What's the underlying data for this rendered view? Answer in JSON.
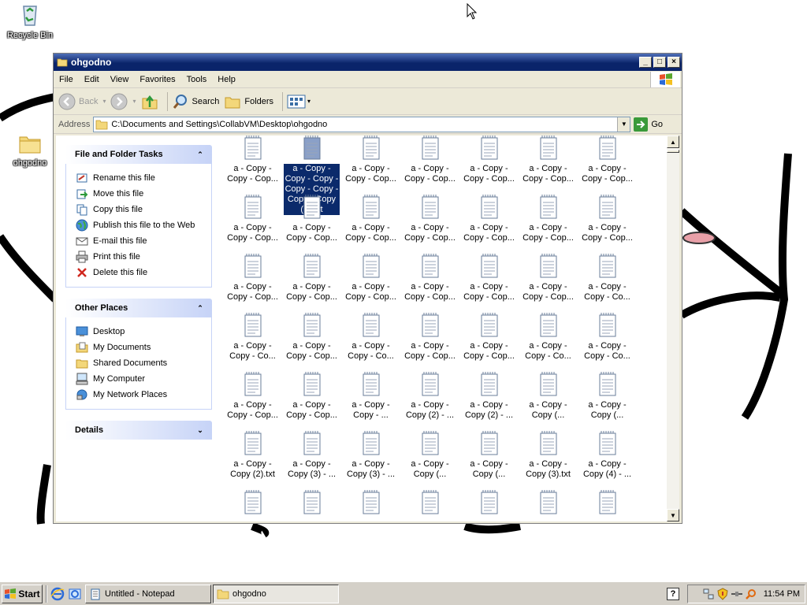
{
  "desktop": {
    "icons": [
      {
        "label": "Recycle Bin",
        "icon": "recycle-bin-icon"
      },
      {
        "label": "ohgodno",
        "icon": "folder-icon"
      }
    ]
  },
  "window": {
    "title": "ohgodno",
    "controls": {
      "minimize": "_",
      "maximize": "□",
      "close": "×"
    },
    "menu": [
      "File",
      "Edit",
      "View",
      "Favorites",
      "Tools",
      "Help"
    ],
    "toolbar": {
      "back": "Back",
      "search": "Search",
      "folders": "Folders"
    },
    "address": {
      "label": "Address",
      "value": "C:\\Documents and Settings\\CollabVM\\Desktop\\ohgodno",
      "go": "Go"
    }
  },
  "taskpane": {
    "file_tasks": {
      "title": "File and Folder Tasks",
      "items": [
        {
          "label": "Rename this file",
          "icon": "rename-icon"
        },
        {
          "label": "Move this file",
          "icon": "move-icon"
        },
        {
          "label": "Copy this file",
          "icon": "copy-icon"
        },
        {
          "label": "Publish this file to the Web",
          "icon": "globe-icon"
        },
        {
          "label": "E-mail this file",
          "icon": "email-icon"
        },
        {
          "label": "Print this file",
          "icon": "printer-icon"
        },
        {
          "label": "Delete this file",
          "icon": "delete-icon"
        }
      ]
    },
    "other_places": {
      "title": "Other Places",
      "items": [
        {
          "label": "Desktop",
          "icon": "desktop-icon"
        },
        {
          "label": "My Documents",
          "icon": "my-documents-icon"
        },
        {
          "label": "Shared Documents",
          "icon": "shared-folder-icon"
        },
        {
          "label": "My Computer",
          "icon": "my-computer-icon"
        },
        {
          "label": "My Network Places",
          "icon": "network-places-icon"
        }
      ]
    },
    "details": {
      "title": "Details"
    }
  },
  "files": {
    "rows": [
      [
        "a - Copy -\nCopy - Cop...",
        "a - Copy -\nCopy - Copy -\nCopy - Copy -\nCopy - Copy\n(2).txt",
        "a - Copy -\nCopy - Cop...",
        "a - Copy -\nCopy - Cop...",
        "a - Copy -\nCopy - Cop...",
        "a - Copy -\nCopy - Cop...",
        "a - Copy -\nCopy - Cop..."
      ],
      [
        "a - Copy -\nCopy - Cop...",
        "a - Copy -\nCopy - Cop...",
        "a - Copy -\nCopy - Cop...",
        "a - Copy -\nCopy - Cop...",
        "a - Copy -\nCopy - Cop...",
        "a - Copy -\nCopy - Cop...",
        "a - Copy -\nCopy - Cop..."
      ],
      [
        "a - Copy -\nCopy - Cop...",
        "a - Copy -\nCopy - Cop...",
        "a - Copy -\nCopy - Cop...",
        "a - Copy -\nCopy - Cop...",
        "a - Copy -\nCopy - Cop...",
        "a - Copy -\nCopy - Cop...",
        "a - Copy -\nCopy - Co..."
      ],
      [
        "a - Copy -\nCopy - Co...",
        "a - Copy -\nCopy - Cop...",
        "a - Copy -\nCopy - Co...",
        "a - Copy -\nCopy - Cop...",
        "a - Copy -\nCopy - Cop...",
        "a - Copy -\nCopy - Co...",
        "a - Copy -\nCopy - Co..."
      ],
      [
        "a - Copy -\nCopy - Cop...",
        "a - Copy -\nCopy - Cop...",
        "a - Copy -\nCopy - ...",
        "a - Copy -\nCopy (2) - ...",
        "a - Copy -\nCopy (2) - ...",
        "a - Copy -\nCopy (...",
        "a - Copy -\nCopy (..."
      ],
      [
        "a - Copy -\nCopy (2).txt",
        "a - Copy -\nCopy (3) - ...",
        "a - Copy -\nCopy (3) - ...",
        "a - Copy -\nCopy (...",
        "a - Copy -\nCopy (...",
        "a - Copy -\nCopy (3).txt",
        "a - Copy -\nCopy (4) - ..."
      ],
      [
        "",
        "",
        "",
        "",
        "",
        "",
        ""
      ]
    ],
    "selected": [
      0,
      1
    ]
  },
  "taskbar": {
    "start": "Start",
    "tasks": [
      {
        "label": "Untitled - Notepad",
        "icon": "notepad-icon",
        "active": false
      },
      {
        "label": "ohgodno",
        "icon": "folder-icon",
        "active": true
      }
    ],
    "tray_icons": [
      "network-icon",
      "security-shield-icon",
      "wire-icon",
      "search-icon"
    ],
    "clock": "11:54 PM",
    "help": "?"
  }
}
